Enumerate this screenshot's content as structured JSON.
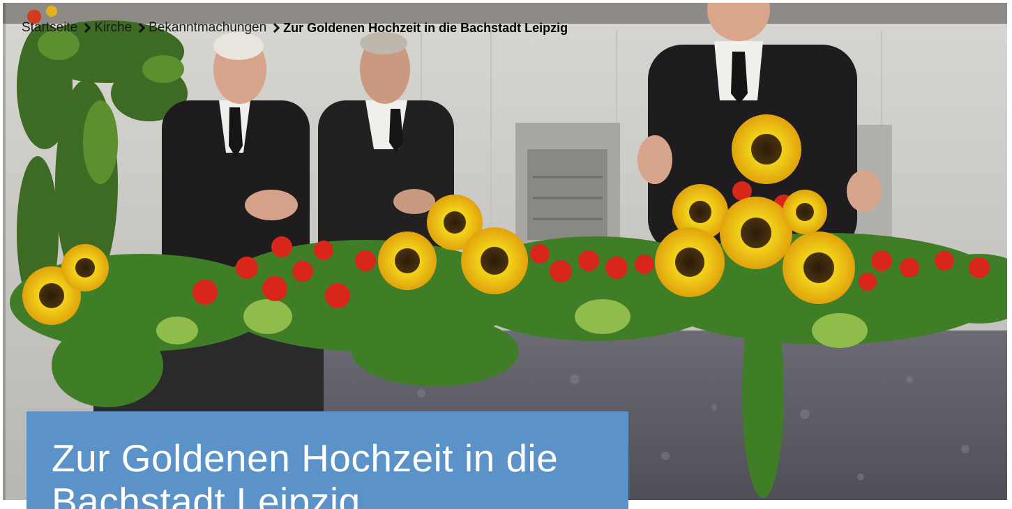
{
  "breadcrumb": {
    "items": [
      {
        "label": "Startseite"
      },
      {
        "label": "Kirche"
      },
      {
        "label": "Bekanntmachungen"
      }
    ],
    "current": "Zur Goldenen Hochzeit in die Bachstadt Leipzig"
  },
  "hero": {
    "title": "Zur Goldenen Hochzeit in die Bachstadt Leipzig",
    "image_subject": "altar-with-sunflower-and-red-flower-arrangement"
  },
  "colors": {
    "title_box": "#5b93c9",
    "title_text": "#ffffff",
    "breadcrumb_text": "#111111"
  },
  "icons": {
    "separator": "chevron-right-icon"
  }
}
